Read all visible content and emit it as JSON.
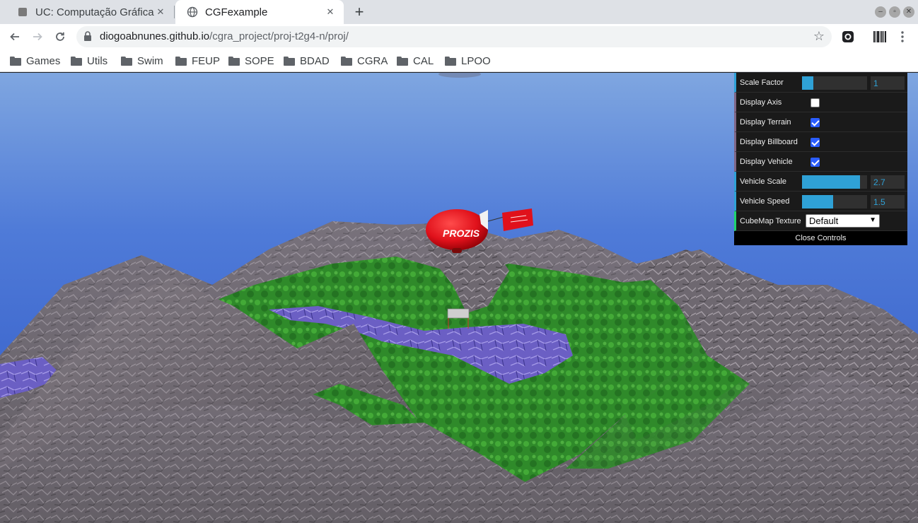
{
  "tabs": [
    {
      "title": "UC: Computação Gráfica",
      "active": false
    },
    {
      "title": "CGFexample",
      "active": true
    }
  ],
  "toolbar": {
    "url_host": "diogoabnunes.github.io",
    "url_path": "/cgra_project/proj-t2g4-n/proj/"
  },
  "bookmarks": [
    "Games",
    "Utils",
    "Swim",
    "FEUP",
    "SOPE",
    "BDAD",
    "CGRA",
    "CAL",
    "LPOO"
  ],
  "scene": {
    "billboard_text": "PROZIS"
  },
  "gui": {
    "scale_factor": {
      "label": "Scale Factor",
      "value": "1",
      "fraction": 0.17
    },
    "display_axis": {
      "label": "Display Axis",
      "checked": false
    },
    "display_terrain": {
      "label": "Display Terrain",
      "checked": true
    },
    "display_billboard": {
      "label": "Display Billboard",
      "checked": true
    },
    "display_vehicle": {
      "label": "Display Vehicle",
      "checked": true
    },
    "vehicle_scale": {
      "label": "Vehicle Scale",
      "value": "2.7",
      "fraction": 0.89
    },
    "vehicle_speed": {
      "label": "Vehicle Speed",
      "value": "1.5",
      "fraction": 0.48
    },
    "cubemap": {
      "label": "CubeMap Texture",
      "selected": "Default"
    },
    "close_label": "Close Controls"
  },
  "colors": {
    "gui_accent": "#2fa1d6",
    "checkbox_blue": "#2b5dff",
    "blimp_red": "#e0111b"
  }
}
